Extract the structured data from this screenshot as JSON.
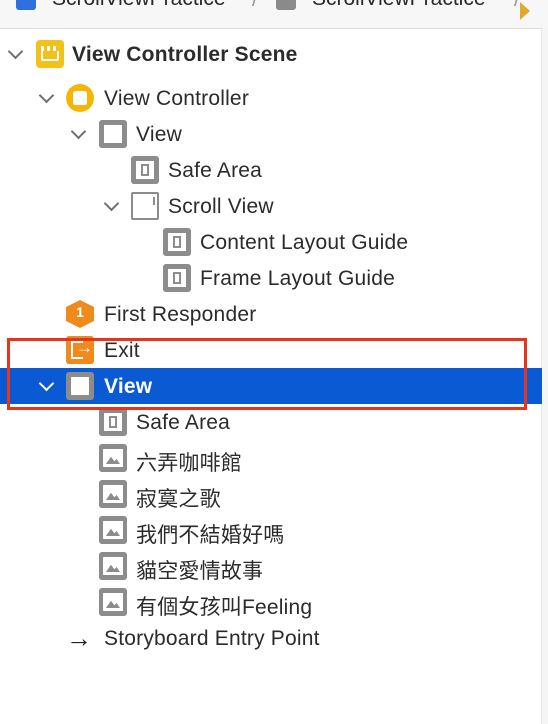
{
  "breadcrumb": {
    "items": [
      "ScrollViewPractice",
      "ScrollViewPractice"
    ]
  },
  "outline": {
    "rows": [
      {
        "label": "View Controller Scene",
        "icon": "storyboard-scene-icon"
      },
      {
        "label": "View Controller",
        "icon": "view-controller-icon"
      },
      {
        "label": "View",
        "icon": "view-icon"
      },
      {
        "label": "Safe Area",
        "icon": "safe-area-icon"
      },
      {
        "label": "Scroll View",
        "icon": "scroll-view-icon"
      },
      {
        "label": "Content Layout Guide",
        "icon": "layout-guide-icon"
      },
      {
        "label": "Frame Layout Guide",
        "icon": "layout-guide-icon"
      },
      {
        "label": "First Responder",
        "icon": "first-responder-icon"
      },
      {
        "label": "Exit",
        "icon": "exit-icon"
      },
      {
        "label": "View",
        "icon": "view-icon"
      },
      {
        "label": "Safe Area",
        "icon": "safe-area-icon"
      },
      {
        "label": "六弄咖啡館",
        "icon": "image-view-icon"
      },
      {
        "label": "寂寞之歌",
        "icon": "image-view-icon"
      },
      {
        "label": "我們不結婚好嗎",
        "icon": "image-view-icon"
      },
      {
        "label": "貓空愛情故事",
        "icon": "image-view-icon"
      },
      {
        "label": "有個女孩叫Feeling",
        "icon": "image-view-icon"
      },
      {
        "label": "Storyboard Entry Point",
        "icon": "arrow-right-icon"
      }
    ]
  },
  "colors": {
    "selection": "#0a5ad4",
    "highlight_box": "#e8331d",
    "scene_icon": "#f2c11a",
    "object_icon": "#f08a1c"
  }
}
